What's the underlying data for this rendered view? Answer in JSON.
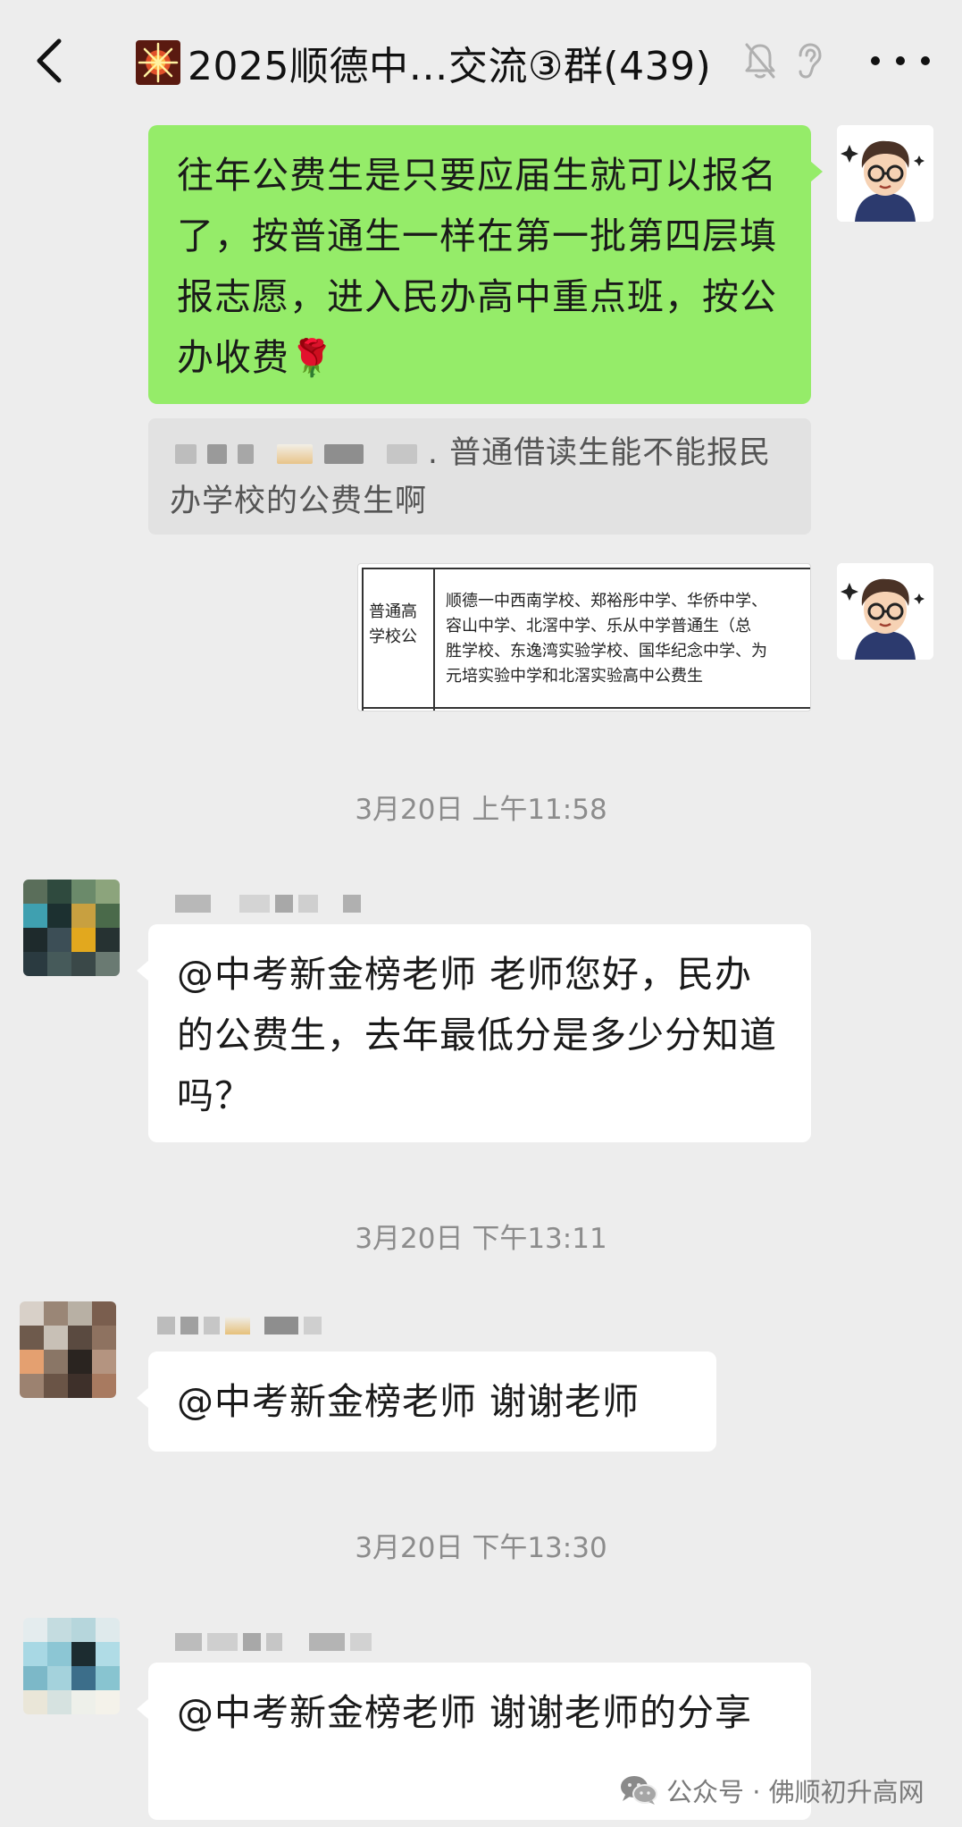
{
  "header": {
    "title": "2025顺德中…交流③群(439)",
    "icons": {
      "back": "back-arrow-icon",
      "title_emoji": "firework-icon",
      "mute": "bell-muted-icon",
      "earpiece": "ear-icon",
      "more": "more-dots-icon"
    }
  },
  "messages": {
    "msg1": {
      "text": "往年公费生是只要应届生就可以报名了，按普通生一样在第一批第四层填报志愿，进入民办高中重点班，按公办收费",
      "emoji": "🌹"
    },
    "quote": {
      "text": ". 普通借读生能不能报民办学校的公费生啊"
    },
    "image": {
      "col1": "普通高学校公",
      "col2": "顺德一中西南学校、郑裕彤中学、华侨中学、\n容山中学、北滘中学、乐从中学普通生（总\n胜学校、东逸湾实验学校、国华纪念中学、为\n元培实验中学和北滘实验高中公费生"
    },
    "ts1": "3月20日 上午11:58",
    "msg2": {
      "text": "@中考新金榜老师  老师您好，民办的公费生，去年最低分是多少分知道吗？"
    },
    "ts2": "3月20日 下午13:11",
    "msg3": {
      "text": "@中考新金榜老师  谢谢老师"
    },
    "ts3": "3月20日 下午13:30",
    "msg4": {
      "text": "@中考新金榜老师  谢谢老师的分享"
    }
  },
  "watermark": {
    "text": "公众号 · 佛顺初升高网",
    "icon": "wechat-icon"
  },
  "colors": {
    "background": "#ededed",
    "self_bubble": "#95ec69",
    "other_bubble": "#ffffff",
    "timestamp": "#8c8c8c"
  }
}
